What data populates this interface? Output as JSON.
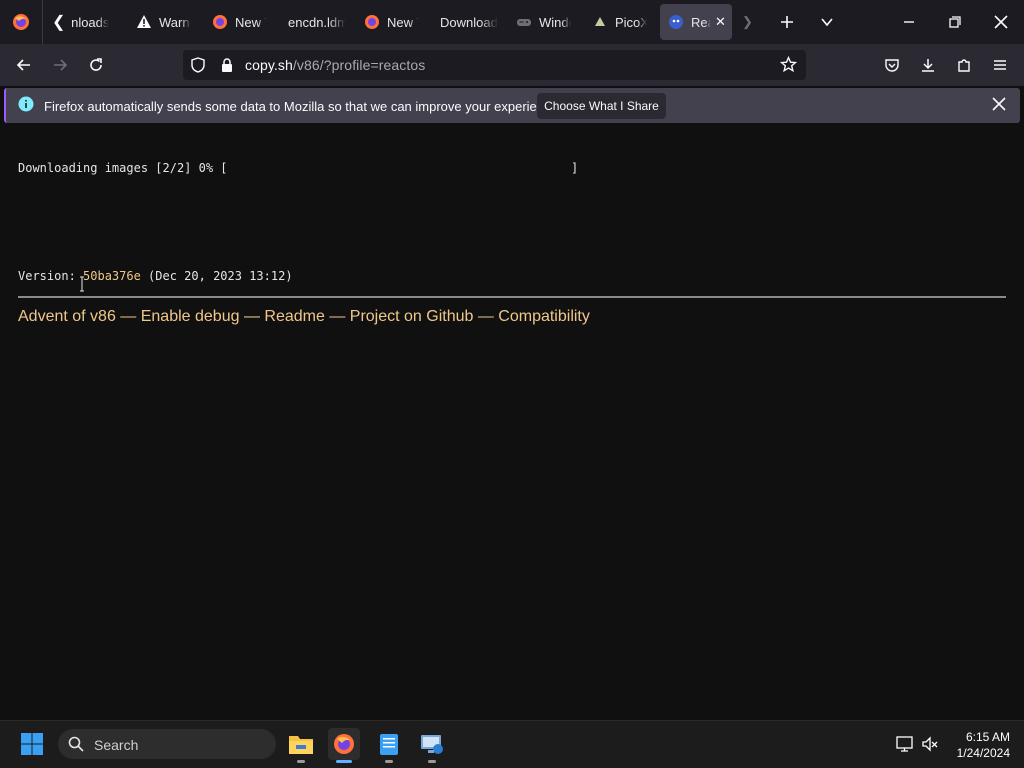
{
  "tabs": [
    {
      "label": "Downloads",
      "icon": "chevron-left-icon"
    },
    {
      "label": "Warning",
      "icon": "warning-icon"
    },
    {
      "label": "New Tab",
      "icon": "firefox-icon"
    },
    {
      "label": "encdn.ldm",
      "icon": "none"
    },
    {
      "label": "New Tab",
      "icon": "firefox-icon"
    },
    {
      "label": "Download",
      "icon": "none"
    },
    {
      "label": "Windows",
      "icon": "gamepad-icon"
    },
    {
      "label": "PicoXT",
      "icon": "pico-icon"
    },
    {
      "label": "ReactOS",
      "icon": "v86-icon",
      "active": true
    }
  ],
  "address": {
    "domain": "copy.sh",
    "path": "/v86/?profile=reactos"
  },
  "notification": {
    "text": "Firefox automatically sends some data to Mozilla so that we can improve your experience.",
    "button": "Choose What I Share"
  },
  "content": {
    "progress_text": "Downloading images [2/2] 0% [",
    "progress_end": "]",
    "progress_percent": 0,
    "version_label": "Version: ",
    "version_hash": "50ba376e",
    "version_date": " (Dec 20, 2023 13:12)",
    "links": [
      "Advent of v86",
      "Enable debug",
      "Readme",
      "Project on Github",
      "Compatibility"
    ],
    "link_separator": " — "
  },
  "taskbar": {
    "search_placeholder": "Search",
    "time": "6:15 AM",
    "date": "1/24/2024"
  },
  "colors": {
    "accent": "#9a5cff",
    "link": "#f0c78a",
    "page_bg": "#101010"
  }
}
